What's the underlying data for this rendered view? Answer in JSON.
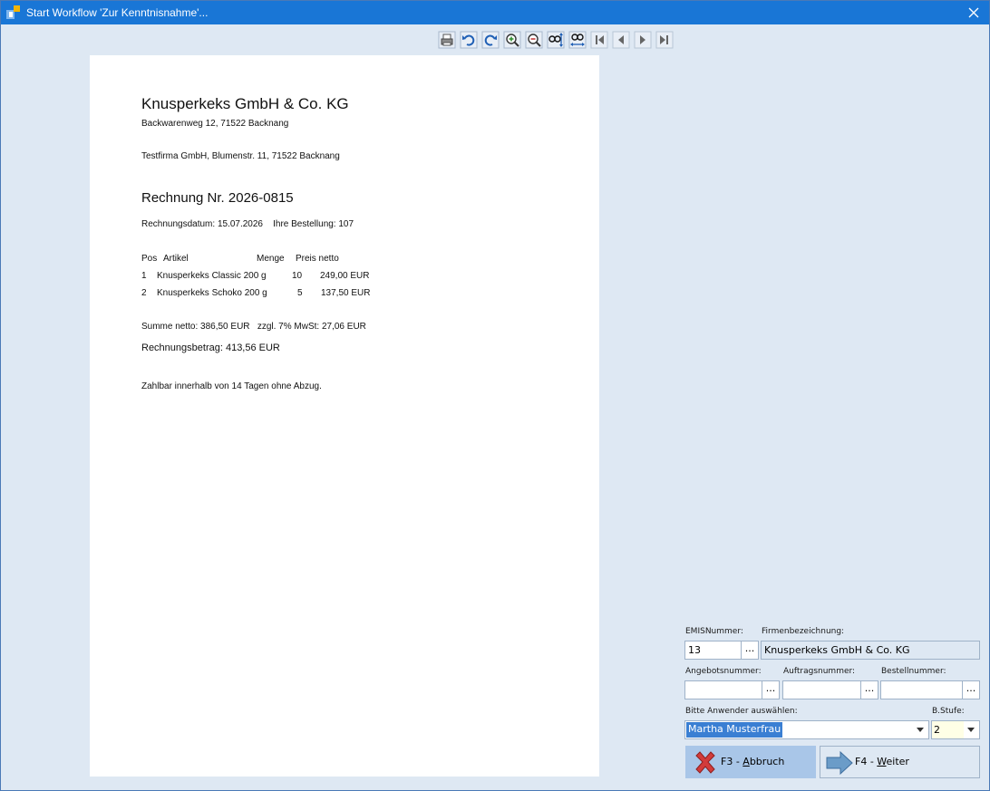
{
  "window": {
    "title": "Start Workflow 'Zur Kenntnisnahme'..."
  },
  "toolbar": {
    "buttons": [
      "print-icon",
      "undo-icon",
      "redo-icon",
      "zoom-in-icon",
      "zoom-out-icon",
      "fit-height-icon",
      "fit-width-icon",
      "first-page-icon",
      "previous-page-icon",
      "next-page-icon",
      "last-page-icon"
    ]
  },
  "document": {
    "company": "Knusperkeks GmbH & Co. KG",
    "sender_address": "Backwarenweg 12, 71522 Backnang",
    "recipient": "Testfirma GmbH, Blumenstr. 11, 71522 Backnang",
    "invoice_title": "Rechnung Nr. 2026-0815",
    "invoice_meta": "Rechnungsdatum: 15.07.2026    Ihre Bestellung: 107",
    "table": {
      "headers": [
        "Pos",
        "Artikel",
        "Menge",
        "Preis netto"
      ],
      "rows": [
        [
          "1",
          "Knusperkeks Classic 200 g",
          "10",
          "249,00 EUR"
        ],
        [
          "2",
          "Knusperkeks Schoko 200 g",
          "5",
          "137,50 EUR"
        ]
      ]
    },
    "sum_line": "Summe netto: 386,50 EUR   zzgl. 7% MwSt: 27,06 EUR",
    "total": "Rechnungsbetrag: 413,56 EUR",
    "terms": "Zahlbar innerhalb von 14 Tagen ohne Abzug."
  },
  "form": {
    "emis_label": "EMISNummer:",
    "emis_value": "13",
    "firma_label": "Firmenbezeichnung:",
    "firma_value": "Knusperkeks GmbH & Co. KG",
    "angebot_label": "Angebotsnummer:",
    "angebot_value": "",
    "auftrag_label": "Auftragsnummer:",
    "auftrag_value": "",
    "bestell_label": "Bestellnummer:",
    "bestell_value": "",
    "ellipsis": "...",
    "anwender_label": "Bitte Anwender auswählen:",
    "anwender_value": "Martha Musterfrau",
    "stufe_label": "B.Stufe:",
    "stufe_value": "2"
  },
  "buttons": {
    "cancel_prefix": "F3 - ",
    "cancel_key": "A",
    "cancel_rest": "bbruch",
    "next_prefix": "F4 - ",
    "next_key": "W",
    "next_rest": "eiter"
  },
  "colors": {
    "titlebar": "#1976d6",
    "window_bg": "#dee8f3",
    "selection": "#3a7fd3",
    "cancel_button_bg": "#a9c6e8",
    "stufe_field_bg": "#ffffe6"
  }
}
